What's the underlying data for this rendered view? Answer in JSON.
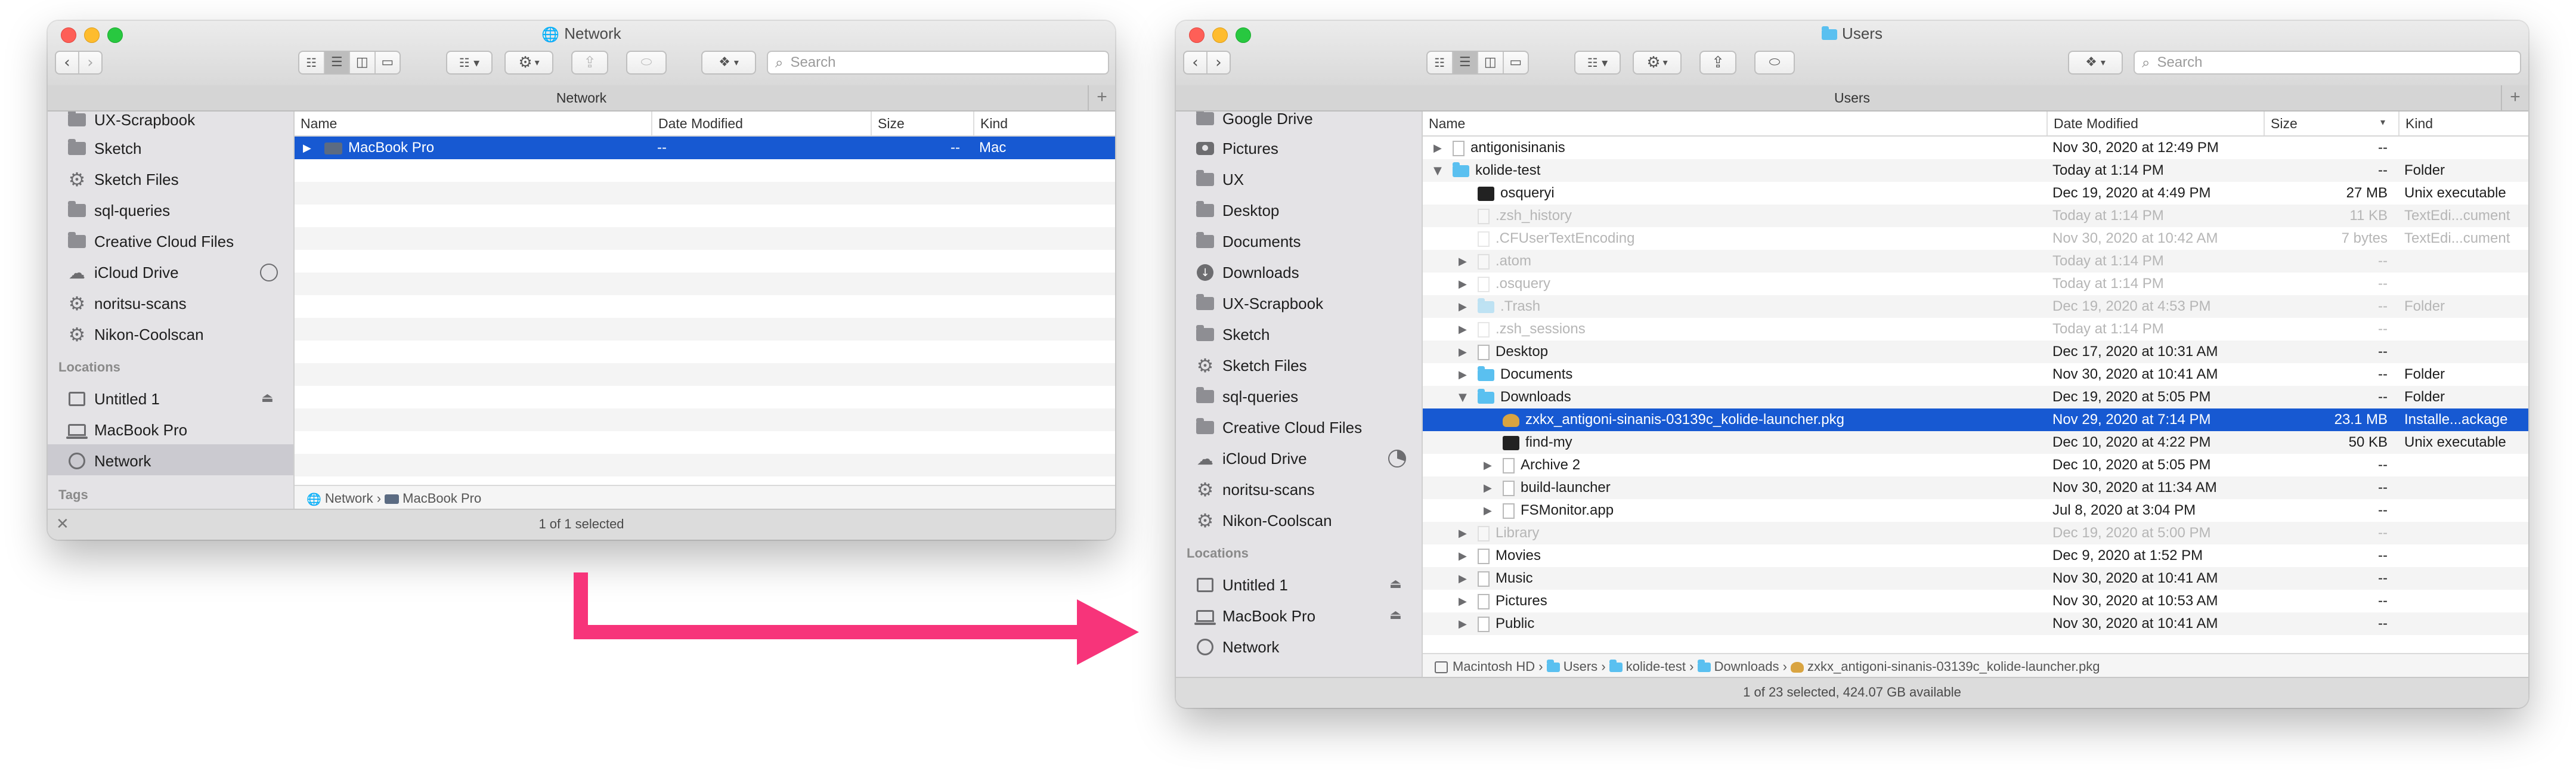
{
  "window1": {
    "title": "Network",
    "tab": "Network",
    "search_placeholder": "Search",
    "sidebar": {
      "items": [
        {
          "label": "UX-Scrapbook",
          "icon": "folder-icon"
        },
        {
          "label": "Sketch",
          "icon": "folder-icon"
        },
        {
          "label": "Sketch Files",
          "icon": "gear-icon"
        },
        {
          "label": "sql-queries",
          "icon": "folder-icon"
        },
        {
          "label": "Creative Cloud Files",
          "icon": "folder-icon"
        },
        {
          "label": "iCloud Drive",
          "icon": "cloud-icon"
        },
        {
          "label": "noritsu-scans",
          "icon": "gear-icon"
        },
        {
          "label": "Nikon-Coolscan",
          "icon": "gear-icon"
        }
      ],
      "locations_heading": "Locations",
      "locations": [
        {
          "label": "Untitled 1",
          "icon": "disk-icon"
        },
        {
          "label": "MacBook Pro",
          "icon": "laptop-icon"
        },
        {
          "label": "Network",
          "icon": "network-icon"
        }
      ],
      "tags_heading": "Tags"
    },
    "columns": [
      "Name",
      "Date Modified",
      "Size",
      "Kind"
    ],
    "rows": [
      {
        "name": "MacBook Pro",
        "date": "--",
        "size": "--",
        "kind": "Mac"
      }
    ],
    "path": [
      "Network",
      "MacBook Pro"
    ],
    "status": "1 of 1 selected"
  },
  "window2": {
    "title": "Users",
    "tab": "Users",
    "search_placeholder": "Search",
    "sidebar": {
      "items": [
        {
          "label": "Google Drive",
          "icon": "folder-icon"
        },
        {
          "label": "Pictures",
          "icon": "camera-icon"
        },
        {
          "label": "UX",
          "icon": "folder-icon"
        },
        {
          "label": "Desktop",
          "icon": "folder-icon"
        },
        {
          "label": "Documents",
          "icon": "folder-icon"
        },
        {
          "label": "Downloads",
          "icon": "download-icon"
        },
        {
          "label": "UX-Scrapbook",
          "icon": "folder-icon"
        },
        {
          "label": "Sketch",
          "icon": "folder-icon"
        },
        {
          "label": "Sketch Files",
          "icon": "gear-icon"
        },
        {
          "label": "sql-queries",
          "icon": "folder-icon"
        },
        {
          "label": "Creative Cloud Files",
          "icon": "folder-icon"
        },
        {
          "label": "iCloud Drive",
          "icon": "cloud-icon"
        },
        {
          "label": "noritsu-scans",
          "icon": "gear-icon"
        },
        {
          "label": "Nikon-Coolscan",
          "icon": "gear-icon"
        }
      ],
      "locations_heading": "Locations",
      "locations": [
        {
          "label": "Untitled 1",
          "icon": "disk-icon"
        },
        {
          "label": "MacBook Pro",
          "icon": "laptop-icon"
        },
        {
          "label": "Network",
          "icon": "network-icon"
        }
      ]
    },
    "columns": [
      "Name",
      "Date Modified",
      "Size",
      "Kind"
    ],
    "rows": [
      {
        "name": "antigonisinanis",
        "date": "Nov 30, 2020 at 12:49 PM",
        "size": "--",
        "kind": ""
      },
      {
        "name": "kolide-test",
        "date": "Today at 1:14 PM",
        "size": "--",
        "kind": "Folder"
      },
      {
        "name": "osqueryi",
        "date": "Dec 19, 2020 at 4:49 PM",
        "size": "27 MB",
        "kind": "Unix executable"
      },
      {
        "name": ".zsh_history",
        "date": "Today at 1:14 PM",
        "size": "11 KB",
        "kind": "TextEdi...cument"
      },
      {
        "name": ".CFUserTextEncoding",
        "date": "Nov 30, 2020 at 10:42 AM",
        "size": "7 bytes",
        "kind": "TextEdi...cument"
      },
      {
        "name": ".atom",
        "date": "Today at 1:14 PM",
        "size": "--",
        "kind": ""
      },
      {
        "name": ".osquery",
        "date": "Today at 1:14 PM",
        "size": "--",
        "kind": ""
      },
      {
        "name": ".Trash",
        "date": "Dec 19, 2020 at 4:53 PM",
        "size": "--",
        "kind": "Folder"
      },
      {
        "name": ".zsh_sessions",
        "date": "Today at 1:14 PM",
        "size": "--",
        "kind": ""
      },
      {
        "name": "Desktop",
        "date": "Dec 17, 2020 at 10:31 AM",
        "size": "--",
        "kind": ""
      },
      {
        "name": "Documents",
        "date": "Nov 30, 2020 at 10:41 AM",
        "size": "--",
        "kind": "Folder"
      },
      {
        "name": "Downloads",
        "date": "Dec 19, 2020 at 5:05 PM",
        "size": "--",
        "kind": "Folder"
      },
      {
        "name": "zxkx_antigoni-sinanis-03139c_kolide-launcher.pkg",
        "date": "Nov 29, 2020 at 7:14 PM",
        "size": "23.1 MB",
        "kind": "Installe...ackage"
      },
      {
        "name": "find-my",
        "date": "Dec 10, 2020 at 4:22 PM",
        "size": "50 KB",
        "kind": "Unix executable"
      },
      {
        "name": "Archive 2",
        "date": "Dec 10, 2020 at 5:05 PM",
        "size": "--",
        "kind": ""
      },
      {
        "name": "build-launcher",
        "date": "Nov 30, 2020 at 11:34 AM",
        "size": "--",
        "kind": ""
      },
      {
        "name": "FSMonitor.app",
        "date": "Jul 8, 2020 at 3:04 PM",
        "size": "--",
        "kind": ""
      },
      {
        "name": "Library",
        "date": "Dec 19, 2020 at 5:00 PM",
        "size": "--",
        "kind": ""
      },
      {
        "name": "Movies",
        "date": "Dec 9, 2020 at 1:52 PM",
        "size": "--",
        "kind": ""
      },
      {
        "name": "Music",
        "date": "Nov 30, 2020 at 10:41 AM",
        "size": "--",
        "kind": ""
      },
      {
        "name": "Pictures",
        "date": "Nov 30, 2020 at 10:53 AM",
        "size": "--",
        "kind": ""
      },
      {
        "name": "Public",
        "date": "Nov 30, 2020 at 10:41 AM",
        "size": "--",
        "kind": ""
      }
    ],
    "path": [
      "Macintosh HD",
      "Users",
      "kolide-test",
      "Downloads",
      "zxkx_antigoni-sinanis-03139c_kolide-launcher.pkg"
    ],
    "status": "1 of 23 selected, 424.07 GB available"
  },
  "colors": {
    "selection": "#1759d2",
    "arrow": "#f7347a",
    "folder": "#5ac0f0"
  }
}
